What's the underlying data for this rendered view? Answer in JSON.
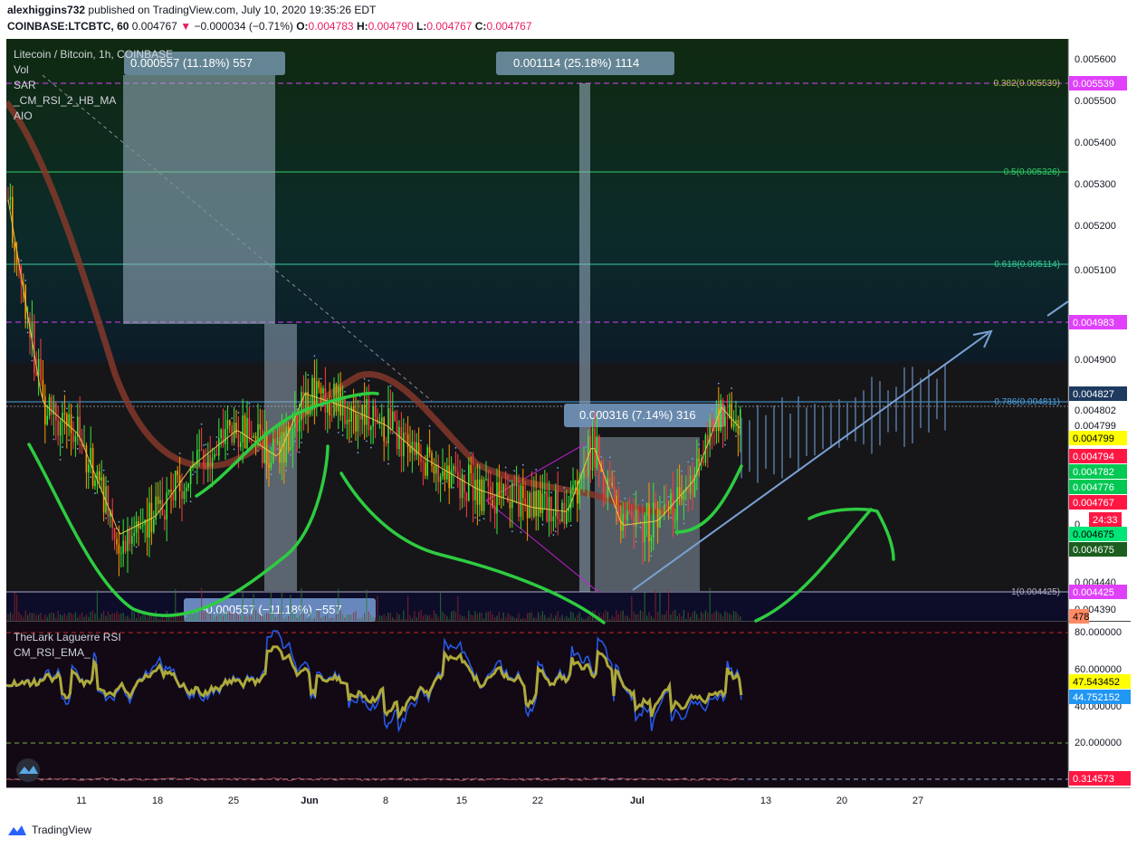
{
  "header": {
    "user": "alexhiggins732",
    "published": "published on TradingView.com, July 10, 2020 19:35:26 EDT",
    "symbol": "COINBASE:LTCBTC, 60",
    "last": "0.004767",
    "change_arrow": "▼",
    "change": "−0.000034 (−0.71%)",
    "o_label": "O:",
    "o_value": "0.004783",
    "h_label": "H:",
    "h_value": "0.004790",
    "l_label": "L:",
    "l_value": "0.004767",
    "c_label": "C:",
    "c_value": "0.004767"
  },
  "legend": {
    "title": "Litecoin / Bitcoin, 1h, COINBASE",
    "items": [
      "Vol",
      "SAR",
      "_CM_RSI_2_HB_MA",
      "AIO"
    ]
  },
  "rsi_legend": {
    "items": [
      "TheLark Laguerre RSI",
      "CM_RSI_EMA_"
    ]
  },
  "measures": [
    "0.000557 (11.18%) 557",
    "0.001114 (25.18%) 1114",
    "0.000316 (7.14%) 316",
    "−0.000557 (−11.18%) −557"
  ],
  "fib_labels": [
    "0.382(0.005539)",
    "0.5(0.005326)",
    "0.618(0.005114)",
    "0.786(0.004811)",
    "1(0.004425)"
  ],
  "price_axis": [
    "0.005600",
    "0.005500",
    "0.005400",
    "0.005300",
    "0.005200",
    "0.005100",
    "0.004900",
    "0.004802",
    "0.004799",
    "0.004675",
    "0.004440",
    "0.004390"
  ],
  "price_badges": [
    {
      "text": "0.005539",
      "bg": "#e040fb",
      "fg": "#ffffff"
    },
    {
      "text": "0.004983",
      "bg": "#e040fb",
      "fg": "#ffffff"
    },
    {
      "text": "0.004827",
      "bg": "#1e3a5f",
      "fg": "#ffffff"
    },
    {
      "text": "0.004799",
      "bg": "#ffff00",
      "fg": "#000000"
    },
    {
      "text": "0.004794",
      "bg": "#ff1744",
      "fg": "#ffffff"
    },
    {
      "text": "0.004782",
      "bg": "#00c853",
      "fg": "#ffffff"
    },
    {
      "text": "0.004776",
      "bg": "#00c853",
      "fg": "#ffffff"
    },
    {
      "text": "0.004767",
      "bg": "#ff1744",
      "fg": "#ffffff"
    },
    {
      "text": "24:33",
      "bg": "#ff1744",
      "fg": "#ffffff"
    },
    {
      "text": "0.004675",
      "bg": "#00e676",
      "fg": "#000000"
    },
    {
      "text": "0.004675",
      "bg": "#1b5e20",
      "fg": "#ffffff"
    },
    {
      "text": "0.004425",
      "bg": "#e040fb",
      "fg": "#ffffff"
    },
    {
      "text": "478",
      "bg": "#ff8a65",
      "fg": "#000000"
    }
  ],
  "price_axis_partial": "0.",
  "rsi_axis": [
    "80.000000",
    "60.000000",
    "40.000000",
    "20.000000"
  ],
  "rsi_badges": [
    {
      "text": "47.543452",
      "bg": "#ffff00",
      "fg": "#000000"
    },
    {
      "text": "44.752152",
      "bg": "#2196f3",
      "fg": "#ffffff"
    },
    {
      "text": "0.314573",
      "bg": "#ff1744",
      "fg": "#ffffff"
    }
  ],
  "x_axis": [
    "11",
    "18",
    "25",
    "Jun",
    "8",
    "15",
    "22",
    "Jul",
    "13",
    "20",
    "27"
  ],
  "footer": {
    "brand": "TradingView"
  },
  "colors": {
    "bg_dark": "#161619",
    "green_draw": "#2ecc40",
    "ma_brown": "#8b3a2a",
    "fib_green": "#33cc66",
    "magenta": "#e040fb",
    "measure_box": "#c8d6e5",
    "rsi_blue": "#2962ff",
    "rsi_yellow": "#b5b03a"
  },
  "chart_data": [
    {
      "type": "line",
      "title": "Litecoin / Bitcoin, 1h, COINBASE",
      "x": [
        "11",
        "18",
        "25",
        "Jun",
        "8",
        "15",
        "22",
        "Jul",
        "13",
        "20",
        "27"
      ],
      "series": [
        {
          "name": "Litecoin / Bitcoin",
          "values": [
            0.00468,
            0.00458,
            0.00476,
            0.00482,
            0.00478,
            0.0047,
            0.00466,
            0.00461,
            0.00478
          ]
        }
      ],
      "ylim": [
        0.00437,
        0.00565
      ],
      "fib_levels": [
        0.005539,
        0.005326,
        0.005114,
        0.004811,
        0.004425
      ]
    },
    {
      "type": "line",
      "title": "TheLark Laguerre RSI",
      "series": [
        {
          "name": "TheLark Laguerre RSI",
          "values": [
            47,
            42,
            58,
            52,
            65,
            48,
            71,
            55,
            60,
            50,
            52,
            58,
            47
          ]
        }
      ],
      "ylim": [
        10,
        82
      ]
    }
  ]
}
